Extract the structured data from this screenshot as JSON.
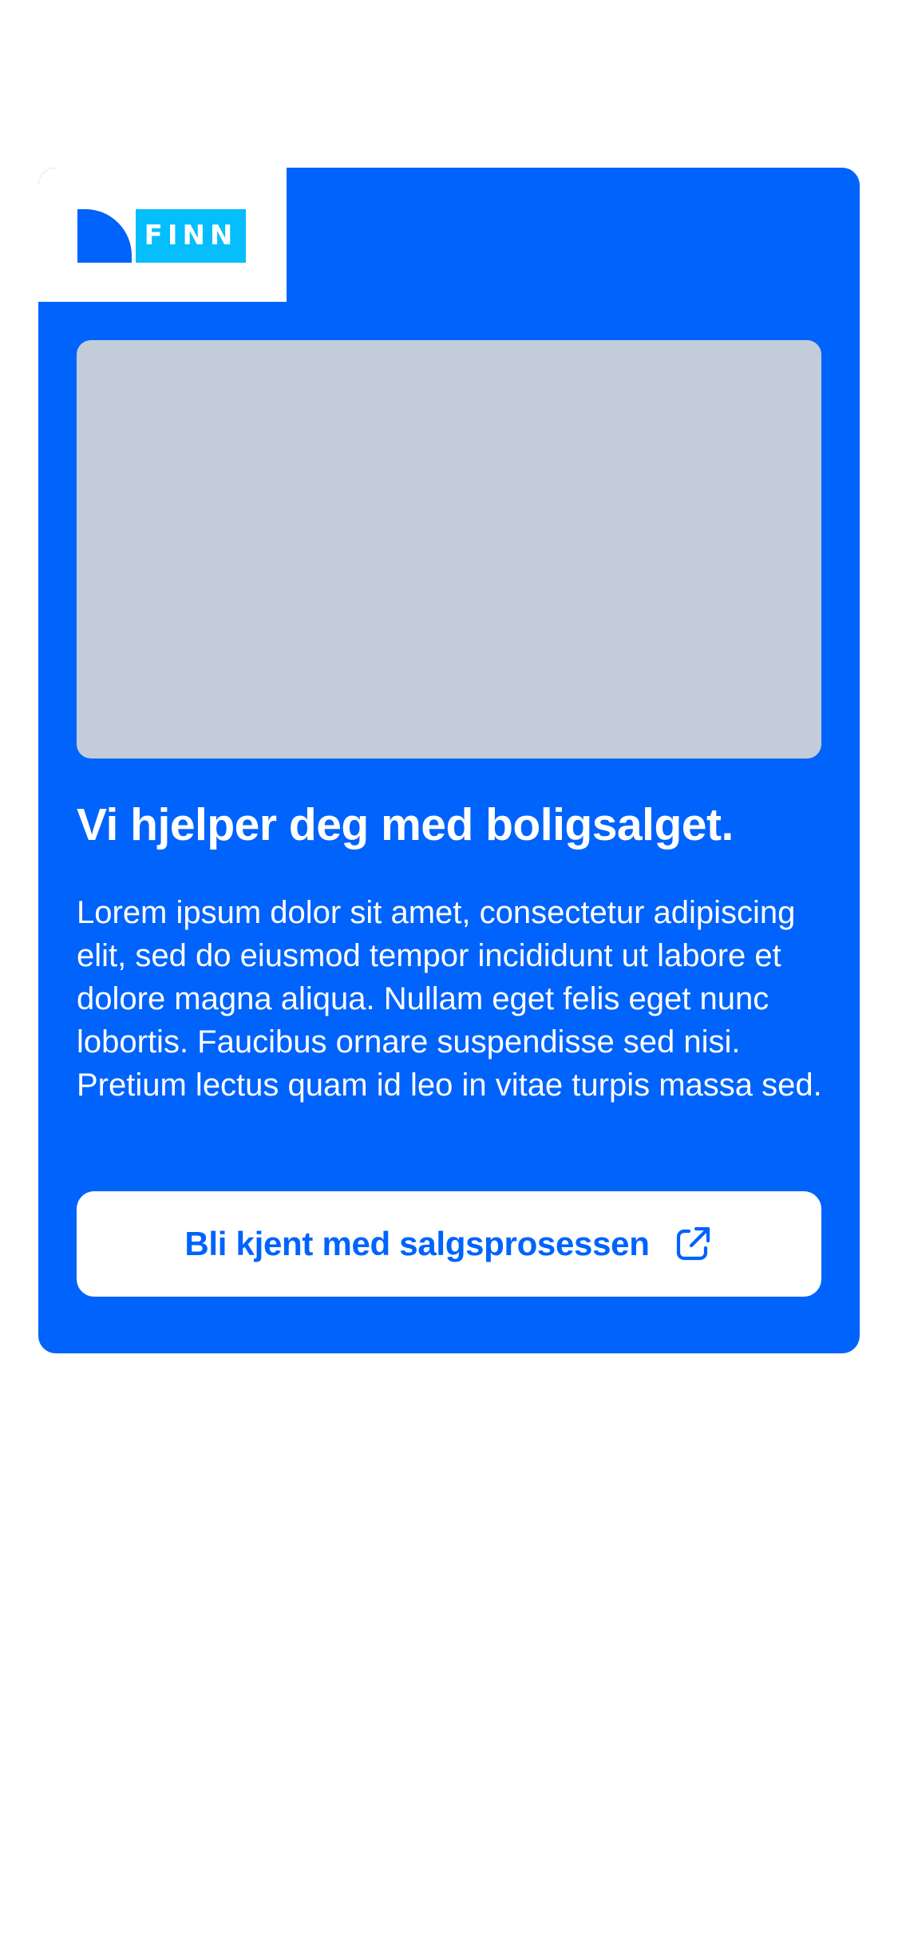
{
  "brand": {
    "logo_text": "FINN",
    "primary_color": "#0063fb",
    "logo_accent_color": "#06befb"
  },
  "card": {
    "image": {
      "icon": "image-placeholder"
    },
    "headline": "Vi hjelper deg med boligsalget.",
    "body": "Lorem ipsum dolor sit amet, consectetur adipiscing elit, sed do eiusmod tempor incididunt ut labore et dolore magna aliqua. Nullam eget felis eget nunc lobortis. Faucibus ornare suspendisse sed nisi. Pretium lectus quam id leo in vitae turpis massa sed.",
    "cta": {
      "label": "Bli kjent med salgsprosessen",
      "icon": "external-link-icon"
    }
  }
}
